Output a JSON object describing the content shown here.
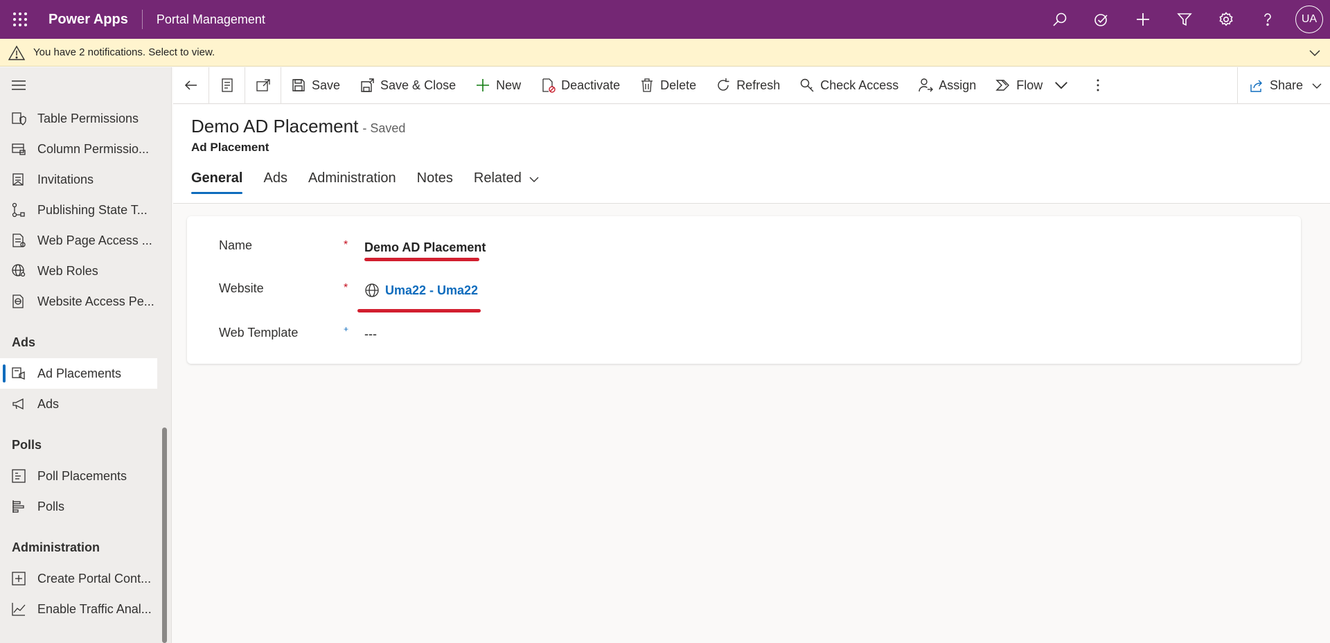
{
  "topbar": {
    "app_name": "Power Apps",
    "area_name": "Portal Management",
    "user_initials": "UA"
  },
  "notification": {
    "text": "You have 2 notifications. Select to view."
  },
  "sidebar": {
    "items_top": [
      {
        "label": "Table Permissions",
        "icon": "shield-doc-icon"
      },
      {
        "label": "Column Permissio...",
        "icon": "column-lock-icon"
      },
      {
        "label": "Invitations",
        "icon": "invitation-icon"
      },
      {
        "label": "Publishing State T...",
        "icon": "flow-icon"
      },
      {
        "label": "Web Page Access ...",
        "icon": "page-access-icon"
      },
      {
        "label": "Web Roles",
        "icon": "globe-person-icon"
      },
      {
        "label": "Website Access Pe...",
        "icon": "website-access-icon"
      }
    ],
    "groups": [
      {
        "title": "Ads",
        "items": [
          {
            "label": "Ad Placements",
            "icon": "ad-placement-icon",
            "active": true
          },
          {
            "label": "Ads",
            "icon": "megaphone-icon"
          }
        ]
      },
      {
        "title": "Polls",
        "items": [
          {
            "label": "Poll Placements",
            "icon": "poll-placement-icon"
          },
          {
            "label": "Polls",
            "icon": "poll-icon"
          }
        ]
      },
      {
        "title": "Administration",
        "items": [
          {
            "label": "Create Portal Cont...",
            "icon": "plus-square-icon"
          },
          {
            "label": "Enable Traffic Anal...",
            "icon": "chart-line-icon"
          }
        ]
      }
    ]
  },
  "commands": {
    "save": "Save",
    "save_close": "Save & Close",
    "new": "New",
    "deactivate": "Deactivate",
    "delete": "Delete",
    "refresh": "Refresh",
    "check_access": "Check Access",
    "assign": "Assign",
    "flow": "Flow",
    "share": "Share"
  },
  "record": {
    "title": "Demo AD Placement",
    "status": "- Saved",
    "entity": "Ad Placement"
  },
  "tabs": [
    "General",
    "Ads",
    "Administration",
    "Notes",
    "Related"
  ],
  "form": {
    "name_label": "Name",
    "name_value": "Demo AD Placement",
    "website_label": "Website",
    "website_value": "Uma22 - Uma22",
    "template_label": "Web Template",
    "template_value": "---",
    "required_mark": "*",
    "recommended_mark": "+"
  },
  "colors": {
    "brand": "#742774",
    "accent": "#0f6cbd",
    "notification_bg": "#fff4ce",
    "annotation_red": "#d21f2f"
  }
}
